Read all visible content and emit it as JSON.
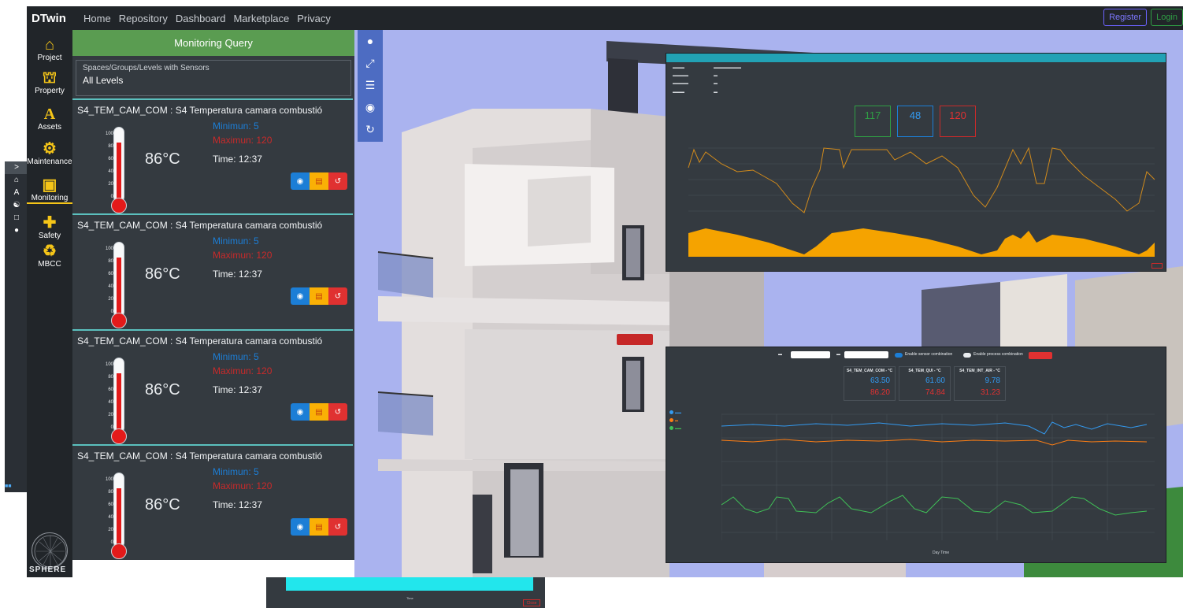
{
  "navbar": {
    "brand": "DTwin",
    "links": [
      "Home",
      "Repository",
      "Dashboard",
      "Marketplace",
      "Privacy"
    ],
    "register_label": "Register",
    "login_label": "Login"
  },
  "sidebar": {
    "items": [
      {
        "label": "Project",
        "icon": "home-icon"
      },
      {
        "label": "Property",
        "icon": "bank-icon"
      },
      {
        "label": "Assets",
        "icon": "letter-a-icon"
      },
      {
        "label": "Maintenance",
        "icon": "gears-icon"
      },
      {
        "label": "Monitoring",
        "icon": "monitor-icon",
        "active": true
      },
      {
        "label": "Safety",
        "icon": "first-aid-icon"
      },
      {
        "label": "MBCC",
        "icon": "recycle-icon"
      }
    ],
    "logo_text": "SPHERE"
  },
  "monitoring": {
    "header": "Monitoring Query",
    "filter_label": "Spaces/Groups/Levels with Sensors",
    "filter_value": "All Levels",
    "cards": [
      {
        "title": "S4_TEM_CAM_COM : S4 Temperatura camara combustió",
        "value": "86°C",
        "minimum": "Minimun: 5",
        "maximum": "Maximun: 120",
        "time": "Time: 12:37",
        "fill_fraction": 0.86
      },
      {
        "title": "S4_TEM_CAM_COM : S4 Temperatura camara combustió",
        "value": "86°C",
        "minimum": "Minimun: 5",
        "maximum": "Maximun: 120",
        "time": "Time: 12:37",
        "fill_fraction": 0.86
      },
      {
        "title": "S4_TEM_CAM_COM : S4 Temperatura camara combustió",
        "value": "86°C",
        "minimum": "Minimun: 5",
        "maximum": "Maximun: 120",
        "time": "Time: 12:37",
        "fill_fraction": 0.86
      },
      {
        "title": "S4_TEM_CAM_COM : S4 Temperatura camara combustió",
        "value": "86°C",
        "minimum": "Minimun: 5",
        "maximum": "Maximun: 120",
        "time": "Time: 12:37",
        "fill_fraction": 0.86
      }
    ],
    "scale_ticks": [
      "100",
      "80",
      "60",
      "40",
      "20",
      "0"
    ]
  },
  "viewport_tools": [
    "camera-icon",
    "expand-icon",
    "sliders-icon",
    "eye-icon",
    "sync-icon"
  ],
  "detail": {
    "values": [
      "117",
      "48",
      "120"
    ]
  },
  "compare": {
    "columns": [
      {
        "title": "S4_TEM_CAM_COM - °C",
        "v1": "63.50",
        "v2": "86.20"
      },
      {
        "title": "S4_TEM_QUI - °C",
        "v1": "61.60",
        "v2": "74.84"
      },
      {
        "title": "S4_TEM_INT_AIR - °C",
        "v1": "9.78",
        "v2": "31.23"
      }
    ],
    "toggle_sensor": "Enable sensor combination",
    "toggle_process": "Enable process combination",
    "x_label": "Day Time"
  },
  "cyan": {
    "x_label": "Time",
    "close_label": "Close"
  },
  "colors": {
    "navbar": "#212529",
    "panel": "#343a40",
    "header_green": "#5a9c51",
    "accent_yellow": "#f5c518",
    "sky": "#aab3ef",
    "thermo_red": "#e31a1a"
  }
}
